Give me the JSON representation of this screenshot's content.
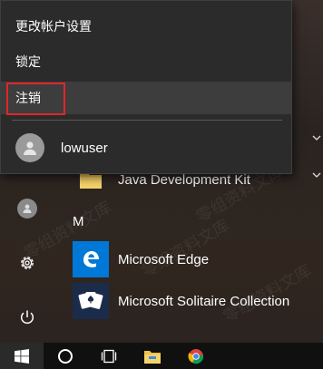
{
  "context_menu": {
    "items": [
      {
        "label": "更改帐户设置"
      },
      {
        "label": "锁定"
      },
      {
        "label": "注销"
      }
    ],
    "user": {
      "name": "lowuser"
    }
  },
  "apps": {
    "java_label": "Java Development Kit",
    "section_letter": "M",
    "edge_label": "Microsoft Edge",
    "solitaire_label": "Microsoft Solitaire Collection"
  },
  "watermark": "零组资料文库",
  "colors": {
    "highlight": "#e0262a",
    "edge_tile": "#0078d7",
    "solitaire_tile": "#1b2b4a",
    "java_tile": "#f2c04a"
  },
  "icons": {
    "rail": [
      "user-icon",
      "settings-gear-icon",
      "power-icon"
    ],
    "taskbar": [
      "windows-start-icon",
      "cortana-circle-icon",
      "task-view-icon",
      "file-explorer-icon",
      "chrome-icon"
    ]
  }
}
